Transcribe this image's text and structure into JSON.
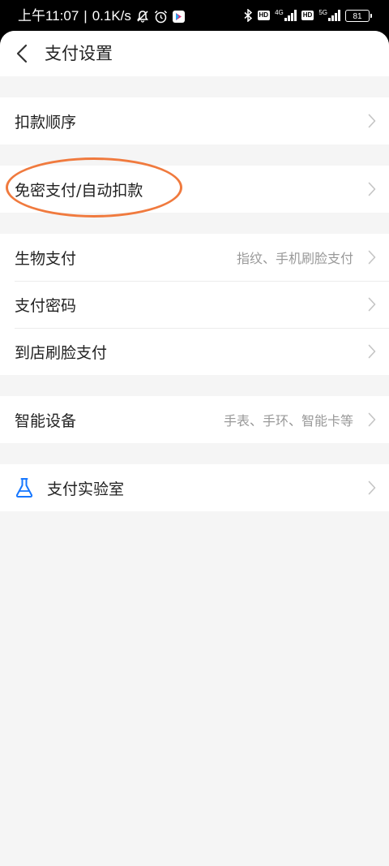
{
  "status_bar": {
    "time": "上午11:07",
    "separator": "|",
    "speed": "0.1K/s",
    "network_1": "4G",
    "network_2": "5G",
    "hd_label": "HD",
    "battery": "81",
    "icons": [
      "mute-icon",
      "alarm-icon",
      "app-notification-icon",
      "bluetooth-icon",
      "signal-icon"
    ]
  },
  "header": {
    "title": "支付设置",
    "back_icon": "chevron-left-icon"
  },
  "sections": [
    {
      "rows": [
        {
          "label": "扣款顺序",
          "value": ""
        }
      ]
    },
    {
      "rows": [
        {
          "label": "免密支付/自动扣款",
          "value": ""
        }
      ]
    },
    {
      "rows": [
        {
          "label": "生物支付",
          "value": "指纹、手机刷脸支付"
        },
        {
          "label": "支付密码",
          "value": ""
        },
        {
          "label": "到店刷脸支付",
          "value": ""
        }
      ]
    },
    {
      "rows": [
        {
          "label": "智能设备",
          "value": "手表、手环、智能卡等"
        }
      ]
    },
    {
      "rows": [
        {
          "label": "支付实验室",
          "value": "",
          "icon": "flask-icon"
        }
      ]
    }
  ],
  "colors": {
    "highlight_oval": "#f07a3e",
    "lab_icon": "#1677ff",
    "page_background": "#f5f5f5"
  }
}
